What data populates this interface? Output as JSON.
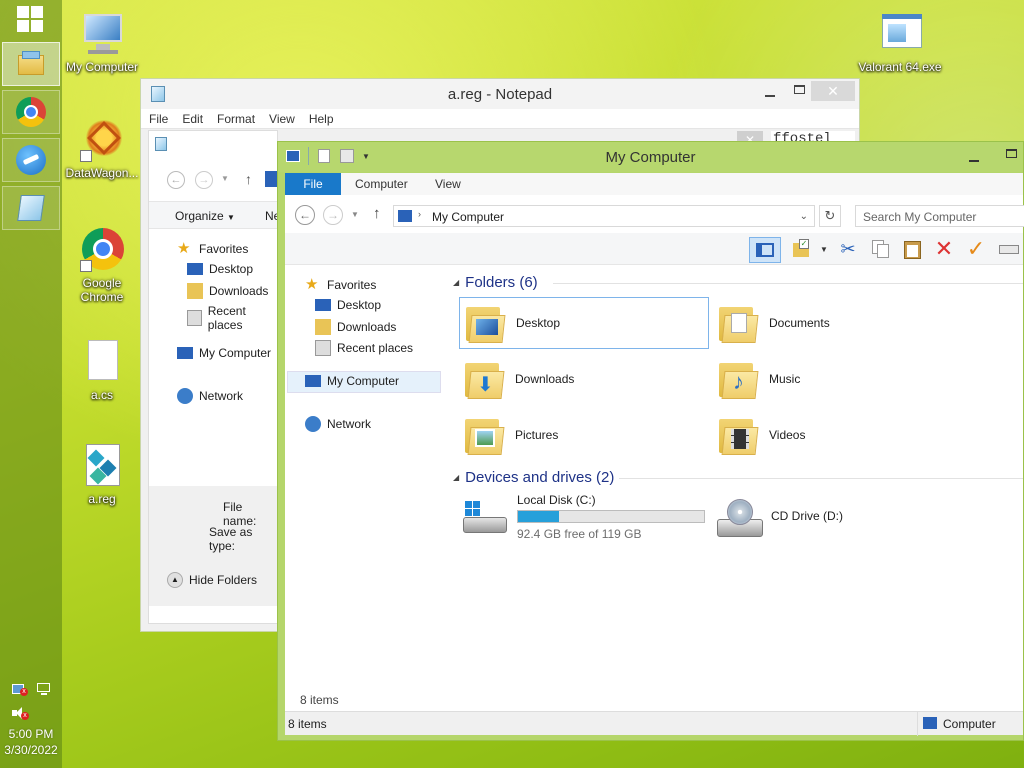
{
  "taskbar": {
    "clock_time": "5:00 PM",
    "clock_date": "3/30/2022",
    "items": [
      "file-explorer-icon",
      "chrome-icon",
      "app-icon",
      "notepad-icon"
    ]
  },
  "desktop": {
    "icons": [
      {
        "label": "My Computer"
      },
      {
        "label": "DataWagon..."
      },
      {
        "label": "Google Chrome"
      },
      {
        "label": "a.cs"
      },
      {
        "label": "a.reg"
      },
      {
        "label": "Valorant 64.exe"
      }
    ]
  },
  "notepad": {
    "title": "a.reg - Notepad",
    "menu": [
      "File",
      "Edit",
      "Format",
      "View",
      "Help"
    ],
    "text_fragment": "ffostel"
  },
  "saveas": {
    "organize_label": "Organize",
    "new_label": "Ne",
    "nav": [
      "Favorites",
      "Desktop",
      "Downloads",
      "Recent places",
      "My Computer",
      "Network"
    ],
    "file_name_label": "File name:",
    "save_type_label": "Save as type:",
    "hide_folders_label": "Hide Folders"
  },
  "explorer": {
    "title": "My Computer",
    "ribbon_tabs": [
      "File",
      "Computer",
      "View"
    ],
    "address": "My Computer",
    "search_placeholder": "Search My Computer",
    "nav": {
      "favorites": "Favorites",
      "desktop": "Desktop",
      "downloads": "Downloads",
      "recent": "Recent places",
      "computer": "My Computer",
      "network": "Network"
    },
    "folders_header": "Folders (6)",
    "folders": [
      "Desktop",
      "Documents",
      "Downloads",
      "Music",
      "Pictures",
      "Videos"
    ],
    "drives_header": "Devices and drives (2)",
    "drives": [
      {
        "name": "Local Disk (C:)",
        "free": "92.4 GB free of 119 GB",
        "used_fraction": 0.22
      },
      {
        "name": "CD Drive (D:)"
      }
    ],
    "items_count_inner": "8 items",
    "status_items": "8 items",
    "status_location": "Computer"
  },
  "colors": {
    "accent": "#1979ca",
    "title_bar_active": "#b7d76e",
    "header_text": "#1e3287"
  }
}
